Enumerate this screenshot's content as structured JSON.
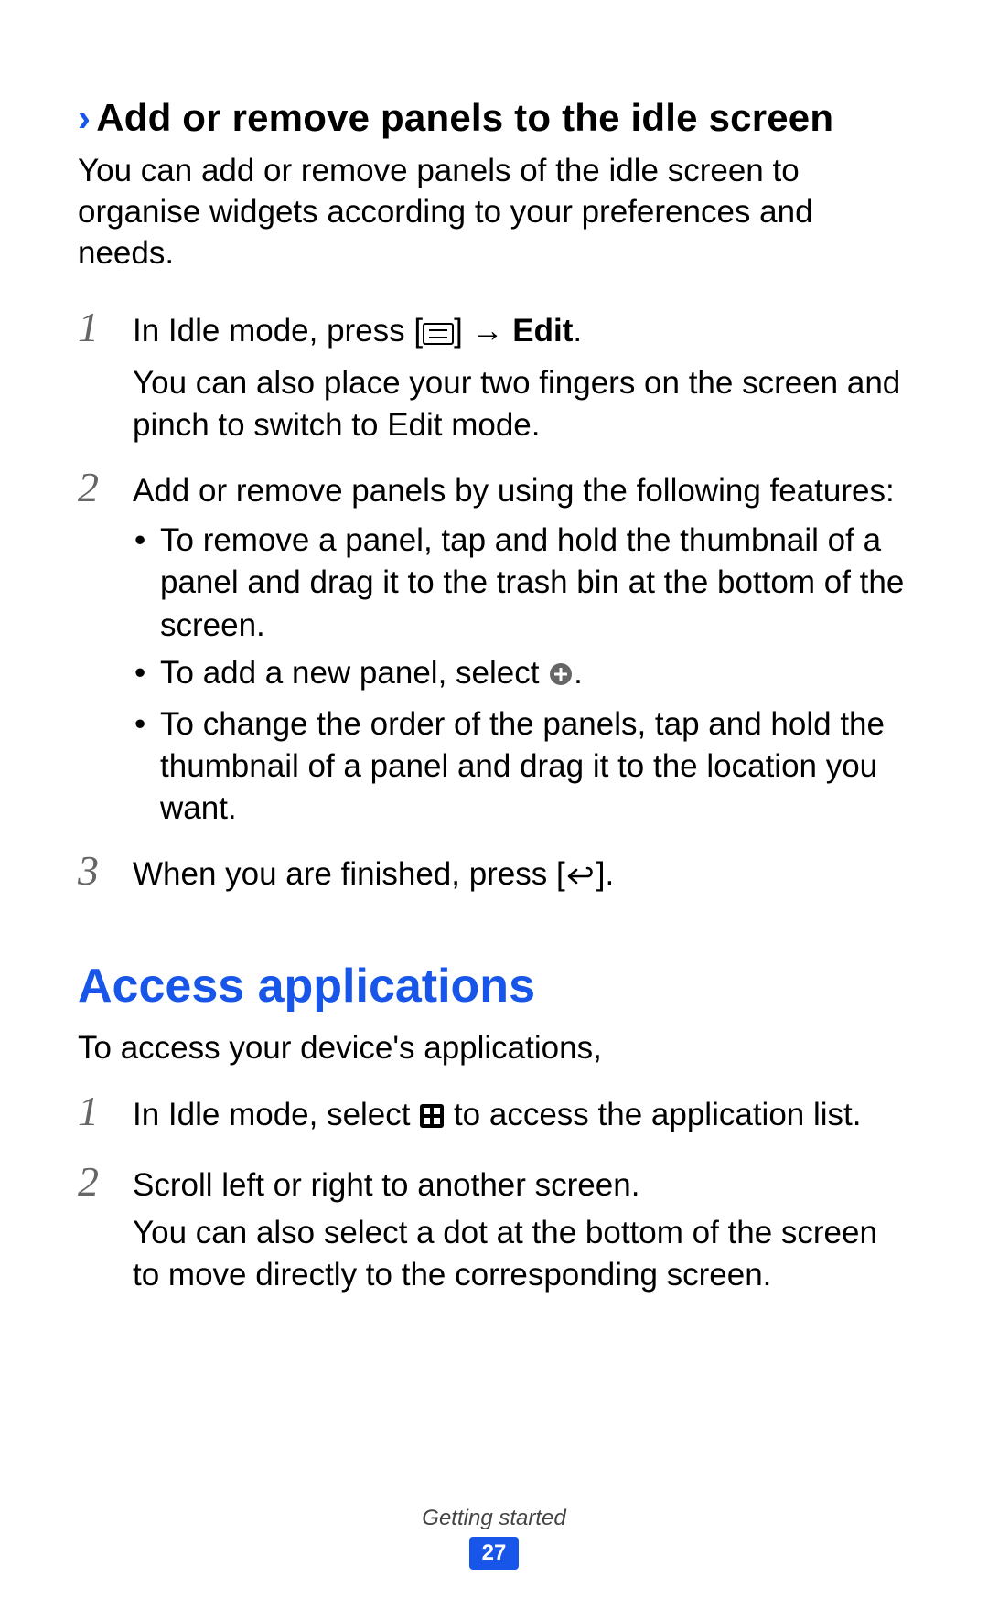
{
  "section1": {
    "heading": "Add or remove panels to the idle screen",
    "intro": "You can add or remove panels of the idle screen to organise widgets according to your preferences and needs.",
    "step1_prefix": "In Idle mode, press [",
    "step1_mid": "] → ",
    "step1_bold": "Edit",
    "step1_suffix": ".",
    "step1_line2": "You can also place your two fingers on the screen and pinch to switch to Edit mode.",
    "step2_intro": "Add or remove panels by using the following features:",
    "step2_b1": "To remove a panel, tap and hold the thumbnail of a panel and drag it to the trash bin at the bottom of the screen.",
    "step2_b2_prefix": "To add a new panel, select ",
    "step2_b2_suffix": ".",
    "step2_b3": "To change the order of the panels, tap and hold the thumbnail of a panel and drag it to the location you want.",
    "step3_prefix": "When you are finished, press [",
    "step3_suffix": "]."
  },
  "section2": {
    "heading": "Access applications",
    "intro": "To access your device's applications,",
    "step1_prefix": "In Idle mode, select ",
    "step1_suffix": " to access the application list.",
    "step2_line1": "Scroll left or right to another screen.",
    "step2_line2": "You can also select a dot at the bottom of the screen to move directly to the corresponding screen."
  },
  "footer": {
    "label": "Getting started",
    "page": "27"
  },
  "nums": {
    "n1": "1",
    "n2": "2",
    "n3": "3"
  }
}
